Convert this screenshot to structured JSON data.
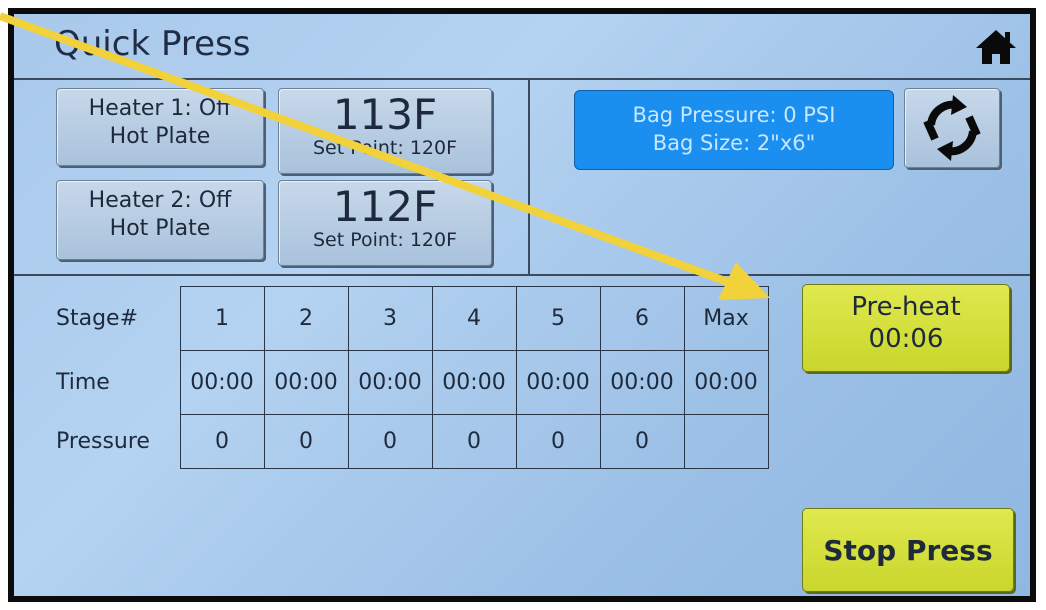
{
  "header": {
    "title": "Quick Press"
  },
  "heaters": [
    {
      "line1": "Heater 1:   Off",
      "line2": "Hot Plate",
      "temp": "113F",
      "setpoint": "Set Point: 120F"
    },
    {
      "line1": "Heater 2:   Off",
      "line2": "Hot Plate",
      "temp": "112F",
      "setpoint": "Set Point: 120F"
    }
  ],
  "bag": {
    "pressure": "Bag Pressure: 0 PSI",
    "size": "Bag Size: 2\"x6\""
  },
  "table": {
    "row_labels": [
      "Stage#",
      "Time",
      "Pressure"
    ],
    "stages": [
      "1",
      "2",
      "3",
      "4",
      "5",
      "6",
      "Max"
    ],
    "times": [
      "00:00",
      "00:00",
      "00:00",
      "00:00",
      "00:00",
      "00:00",
      "00:00"
    ],
    "pressures": [
      "0",
      "0",
      "0",
      "0",
      "0",
      "0",
      ""
    ]
  },
  "preheat": {
    "label": "Pre-heat",
    "time": "00:06"
  },
  "stop": {
    "label": "Stop Press"
  },
  "colors": {
    "accent_blue": "#1a8ff0",
    "yellow": "#d6e03a",
    "arrow": "#f2d23a"
  },
  "icons": {
    "home": "home-icon",
    "refresh": "refresh-icon"
  }
}
